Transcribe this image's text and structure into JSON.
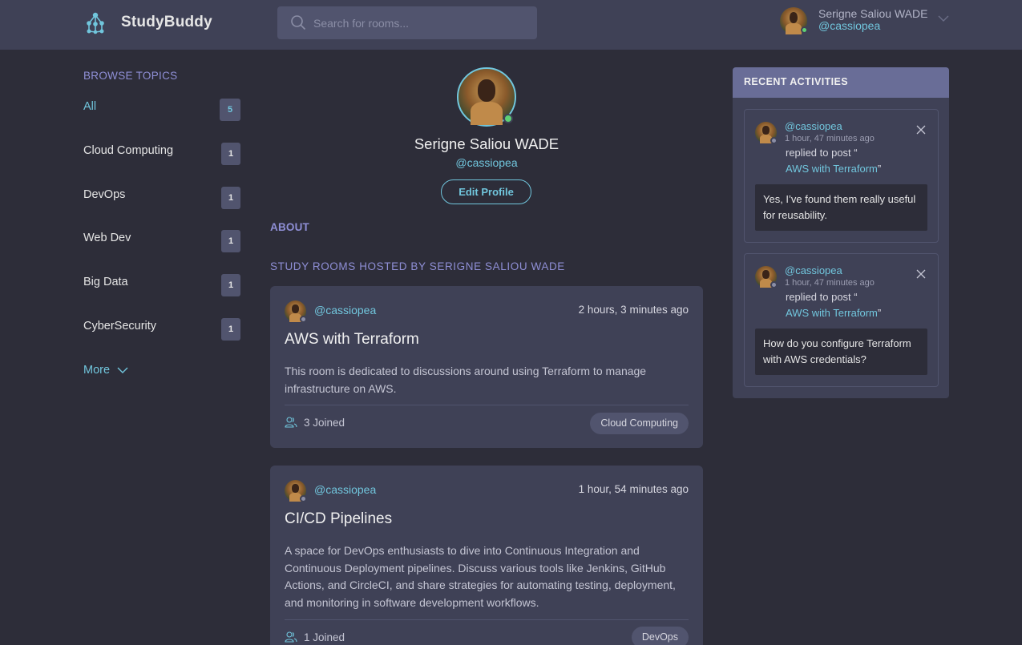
{
  "app": {
    "name": "StudyBuddy"
  },
  "search": {
    "placeholder": "Search for rooms..."
  },
  "user": {
    "name": "Serigne Saliou WADE",
    "handle": "@cassiopea"
  },
  "sidebar": {
    "title": "BROWSE TOPICS",
    "topics": [
      {
        "label": "All",
        "count": "5"
      },
      {
        "label": "Cloud Computing",
        "count": "1"
      },
      {
        "label": "DevOps",
        "count": "1"
      },
      {
        "label": "Web Dev",
        "count": "1"
      },
      {
        "label": "Big Data",
        "count": "1"
      },
      {
        "label": "CyberSecurity",
        "count": "1"
      }
    ],
    "more_label": "More"
  },
  "profile": {
    "name": "Serigne Saliou WADE",
    "handle": "@cassiopea",
    "edit_label": "Edit Profile",
    "about_label": "ABOUT",
    "hosted_label": "STUDY ROOMS HOSTED BY SERIGNE SALIOU WADE"
  },
  "rooms": [
    {
      "host": "@cassiopea",
      "time": "2 hours, 3 minutes ago",
      "title": "AWS with Terraform",
      "description": "This room is dedicated to discussions around using Terraform to manage infrastructure on AWS.",
      "joined": "3 Joined",
      "topic": "Cloud Computing"
    },
    {
      "host": "@cassiopea",
      "time": "1 hour, 54 minutes ago",
      "title": "CI/CD Pipelines",
      "description": "A space for DevOps enthusiasts to dive into Continuous Integration and Continuous Deployment pipelines. Discuss various tools like Jenkins, GitHub Actions, and CircleCI, and share strategies for automating testing, deployment, and monitoring in software development workflows.",
      "joined": "1 Joined",
      "topic": "DevOps"
    }
  ],
  "activities": {
    "title": "RECENT ACTIVITIES",
    "items": [
      {
        "handle": "@cassiopea",
        "time": "1 hour, 47 minutes ago",
        "action": "replied to post “",
        "post": "AWS with Terraform",
        "quote_end": "”",
        "body": "Yes, I’ve found them really useful for reusability."
      },
      {
        "handle": "@cassiopea",
        "time": "1 hour, 47 minutes ago",
        "action": "replied to post “",
        "post": "AWS with Terraform",
        "quote_end": "”",
        "body": "How do you configure Terraform with AWS credentials?"
      }
    ]
  },
  "colors": {
    "background": "#2d2d39",
    "panel": "#3f4156",
    "accent": "#71c6dd",
    "topic_heading": "#8f8fd6",
    "activities_header": "#696d97",
    "online": "#5ed174"
  }
}
